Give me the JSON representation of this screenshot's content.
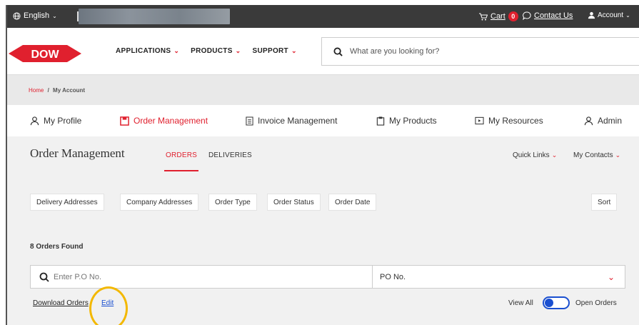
{
  "topbar": {
    "language": "English",
    "cart_label": "Cart",
    "cart_count": "0",
    "contact_label": "Contact Us",
    "account_label": "Account"
  },
  "header": {
    "logo_text": "DOW",
    "nav": [
      {
        "label": "APPLICATIONS"
      },
      {
        "label": "PRODUCTS"
      },
      {
        "label": "SUPPORT"
      }
    ],
    "search_placeholder": "What are you looking for?"
  },
  "breadcrumb": {
    "home": "Home",
    "separator": "/",
    "current": "My Account"
  },
  "account_tabs": [
    {
      "label": "My Profile",
      "icon": "person-icon"
    },
    {
      "label": "Order Management",
      "icon": "order-box-icon",
      "active": true
    },
    {
      "label": "Invoice Management",
      "icon": "document-icon"
    },
    {
      "label": "My Products",
      "icon": "clipboard-icon"
    },
    {
      "label": "My Resources",
      "icon": "play-box-icon"
    },
    {
      "label": "Admin",
      "icon": "person-icon"
    }
  ],
  "order_management": {
    "title": "Order Management",
    "tabs": [
      {
        "label": "ORDERS",
        "active": true
      },
      {
        "label": "DELIVERIES"
      }
    ],
    "quick_links": "Quick Links",
    "my_contacts": "My Contacts"
  },
  "filters": {
    "chips": [
      "Delivery Addresses",
      "Company Addresses",
      "Order Type",
      "Order Status",
      "Order Date"
    ],
    "sort": "Sort"
  },
  "results": {
    "found_text": "8 Orders Found",
    "search_placeholder": "Enter P.O No.",
    "search_by": "PO No.",
    "download_label": "Download Orders",
    "edit_label": "Edit",
    "view_all_label": "View All",
    "open_orders_label": "Open Orders"
  },
  "colors": {
    "brand_red": "#e0202e",
    "topbar": "#3a3a3a",
    "link_blue": "#1a4fd0",
    "highlight": "#f3b800"
  }
}
